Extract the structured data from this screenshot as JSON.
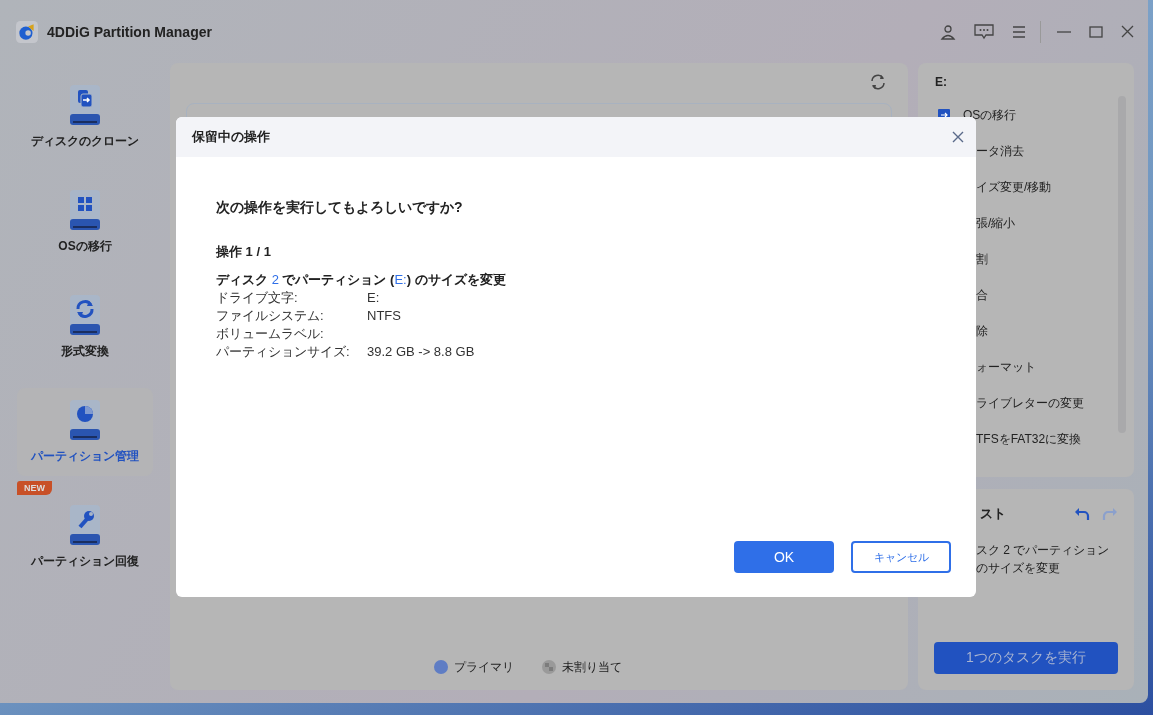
{
  "window": {
    "title": "4DDiG Partition Manager"
  },
  "sidebar": {
    "items": [
      {
        "label": "ディスクのクローン",
        "kind": "clone",
        "selected": false
      },
      {
        "label": "OSの移行",
        "kind": "os",
        "selected": false
      },
      {
        "label": "形式変換",
        "kind": "convert",
        "selected": false
      },
      {
        "label": "パーティション管理",
        "kind": "partition",
        "selected": true
      },
      {
        "label": "パーティション回復",
        "kind": "recovery",
        "selected": false,
        "badge": "NEW"
      }
    ]
  },
  "legend": [
    {
      "label": "プライマリ",
      "kind": "primary"
    },
    {
      "label": "未割り当て",
      "kind": "unallocated"
    }
  ],
  "actions_panel": {
    "title": "E:",
    "items": [
      "OSの移行",
      "ータ消去",
      "イズ変更/移動",
      "張/縮小",
      "割",
      "合",
      "除",
      "ォーマット",
      "ライブレターの変更",
      "TFSをFAT32に変換"
    ]
  },
  "pending_panel": {
    "title": "スト",
    "tasks": [
      "スク 2 でパーティション",
      "のサイズを変更"
    ],
    "run_button": "1つのタスクを実行"
  },
  "dialog": {
    "title": "保留中の操作",
    "question": "次の操作を実行してもよろしいですか?",
    "counter": "操作 1 / 1",
    "headline": [
      {
        "text": "ディスク ",
        "highlight": false
      },
      {
        "text": "2",
        "highlight": true
      },
      {
        "text": " でパーティション (",
        "highlight": false
      },
      {
        "text": "E:",
        "highlight": true
      },
      {
        "text": ") のサイズを変更",
        "highlight": false
      }
    ],
    "details": [
      {
        "label": "ドライブ文字:",
        "value": "E:"
      },
      {
        "label": "ファイルシステム:",
        "value": "NTFS"
      },
      {
        "label": "ボリュームラベル:"
      },
      {
        "label": "パーティションサイズ:",
        "value": "39.2 GB -> 8.8 GB"
      }
    ],
    "ok": "OK",
    "cancel": "キャンセル"
  }
}
